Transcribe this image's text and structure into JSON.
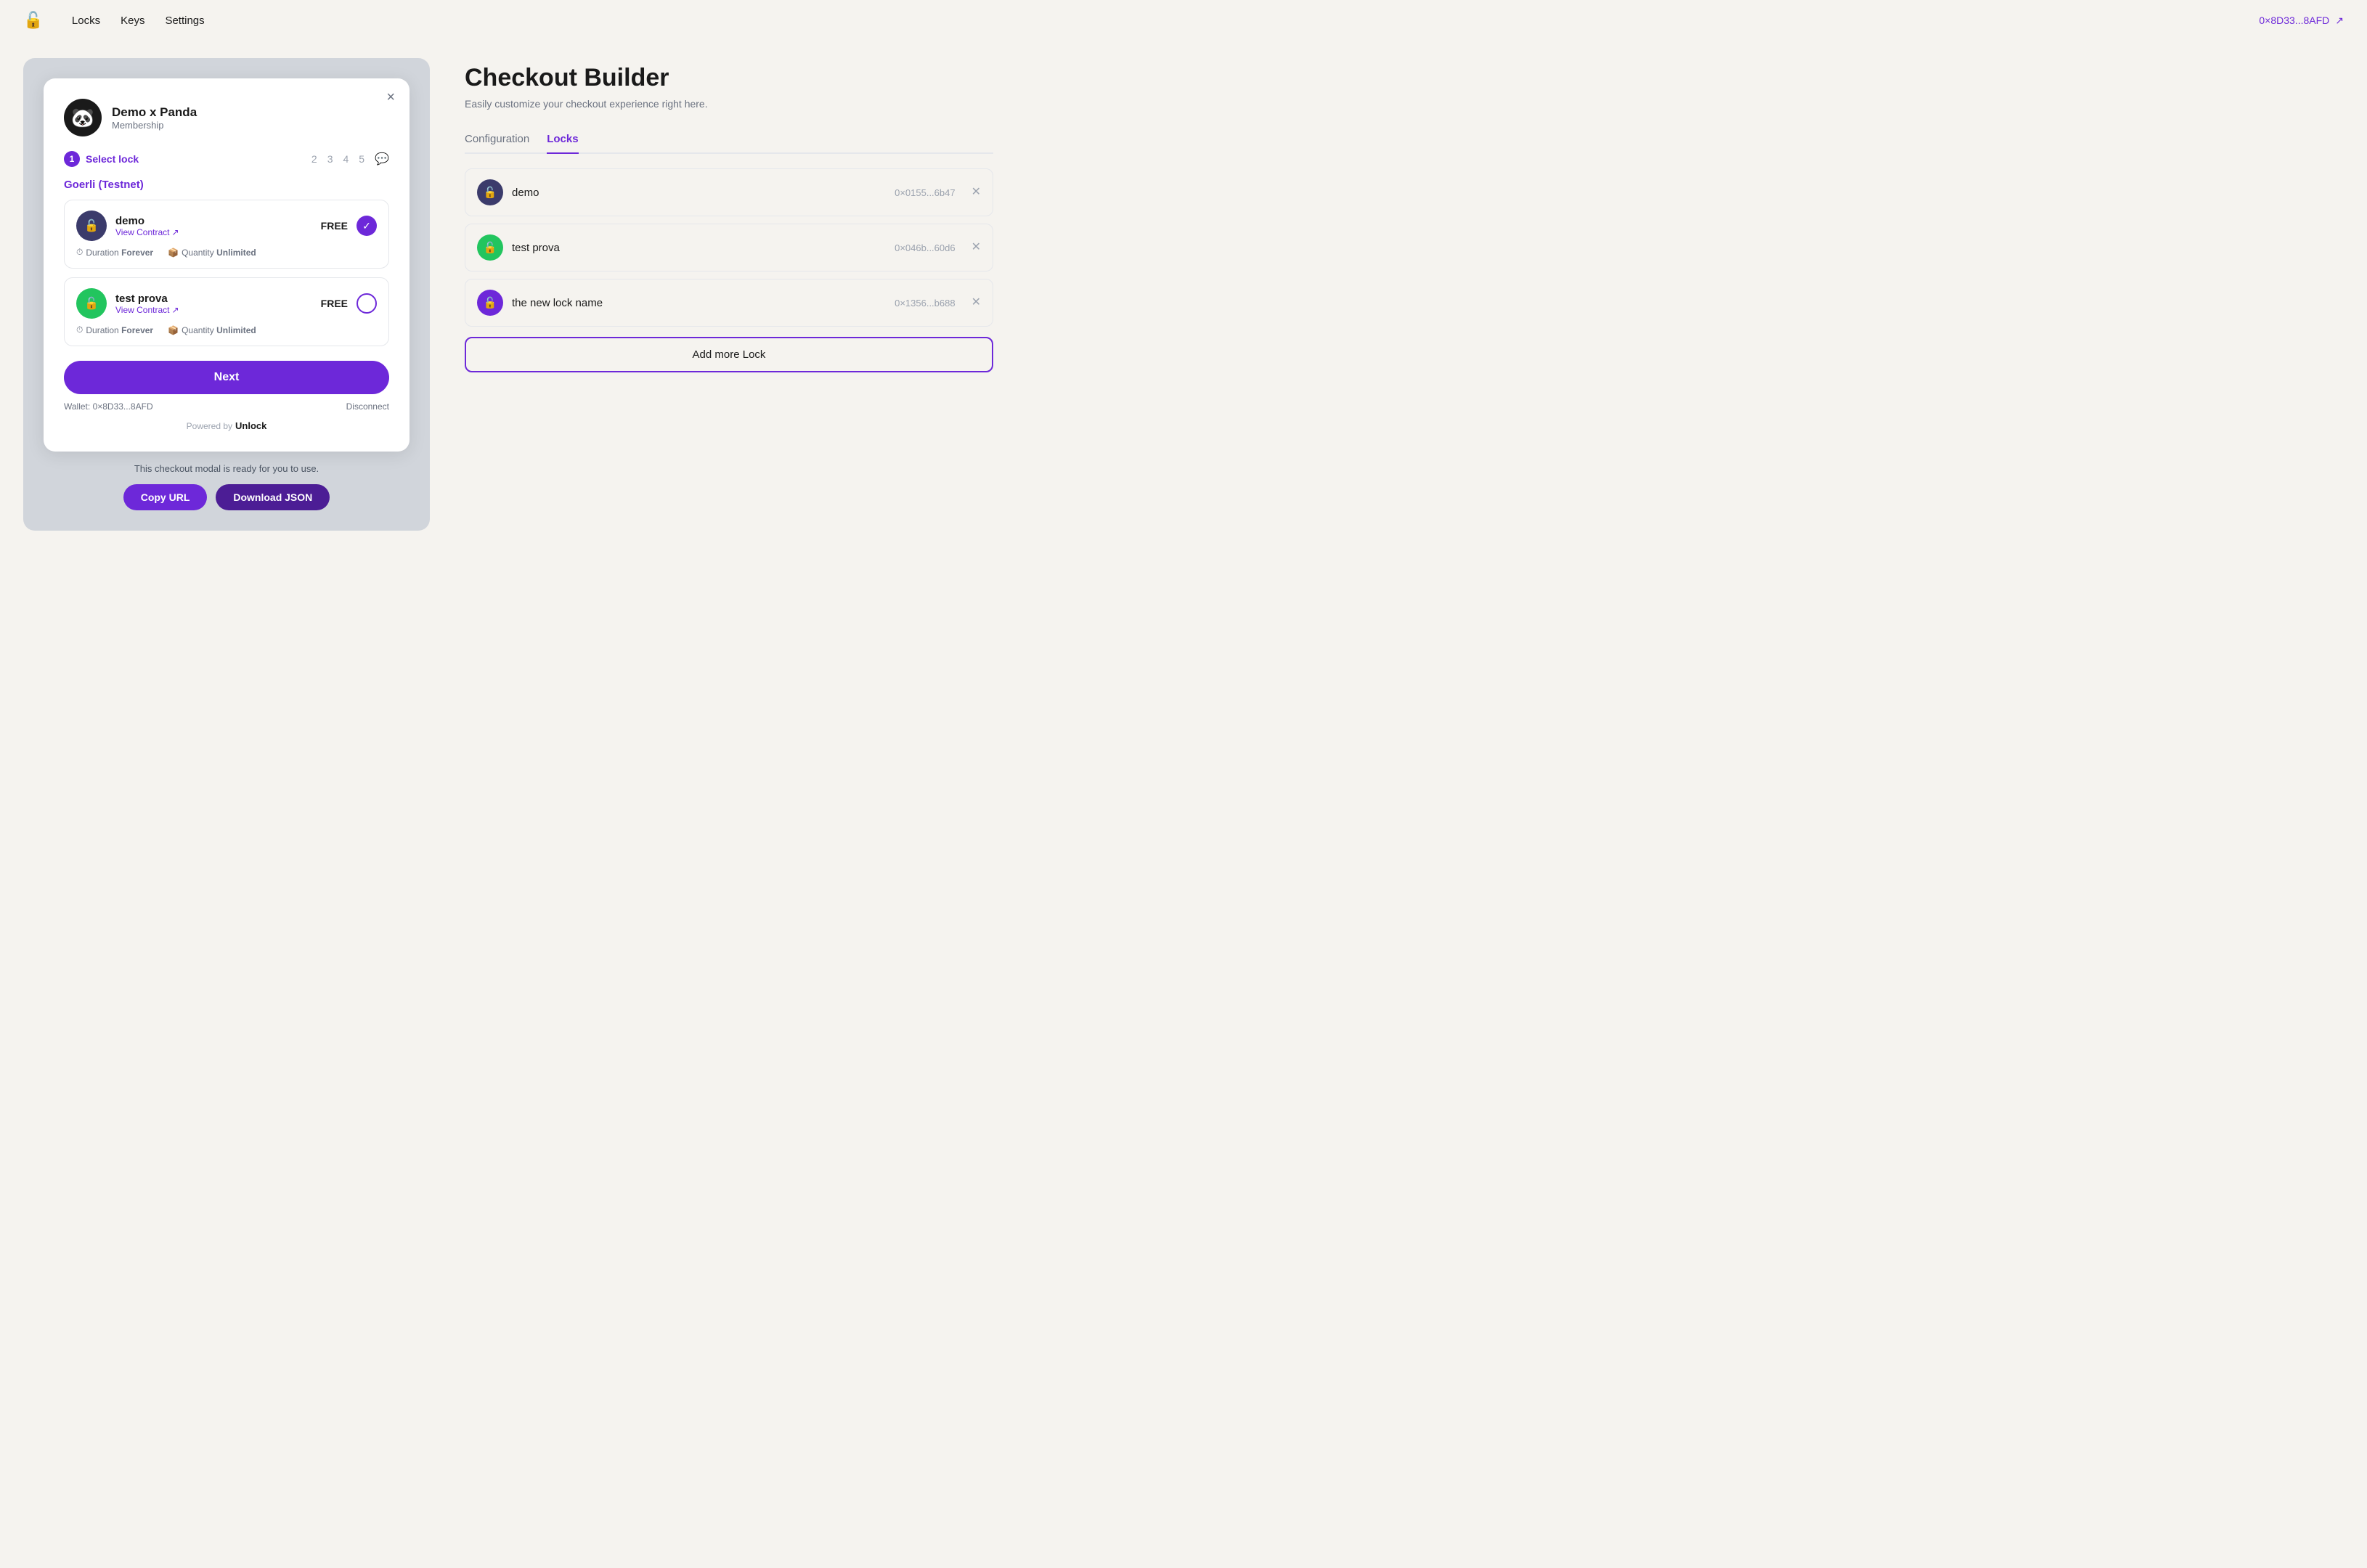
{
  "brand": {
    "name": "Unlock",
    "icon": "🔓"
  },
  "nav": {
    "links": [
      "Locks",
      "Keys",
      "Settings"
    ],
    "wallet": "0×8D33...8AFD"
  },
  "modal": {
    "close_label": "×",
    "panda_emoji": "🐼",
    "title": "Demo x Panda",
    "subtitle": "Membership",
    "step": {
      "number": "1",
      "label": "Select lock",
      "other_steps": [
        "2",
        "3",
        "4",
        "5"
      ],
      "chat_icon": "💬"
    },
    "network": "Goerli (Testnet)",
    "locks": [
      {
        "id": "demo",
        "name": "demo",
        "avatar_bg": "#3b3b6b",
        "avatar_symbol": "🔓",
        "contract_label": "View Contract",
        "price": "FREE",
        "duration": "Forever",
        "quantity": "Unlimited",
        "checked": true
      },
      {
        "id": "test-prova",
        "name": "test prova",
        "avatar_bg": "#22c55e",
        "avatar_symbol": "🔓",
        "contract_label": "View Contract",
        "price": "FREE",
        "duration": "Forever",
        "quantity": "Unlimited",
        "checked": false
      }
    ],
    "next_button": "Next",
    "wallet_label": "Wallet: 0×8D33...8AFD",
    "disconnect_label": "Disconnect",
    "powered_by": "Powered by",
    "powered_brand": "Unlock"
  },
  "checkout_ready_text": "This checkout modal is ready for you to use.",
  "copy_url_label": "Copy URL",
  "download_json_label": "Download JSON",
  "right": {
    "title": "Checkout Builder",
    "subtitle": "Easily customize your checkout experience right here.",
    "tabs": [
      {
        "id": "configuration",
        "label": "Configuration",
        "active": false
      },
      {
        "id": "locks",
        "label": "Locks",
        "active": true
      }
    ],
    "locks": [
      {
        "name": "demo",
        "address": "0×0155...6b47",
        "avatar_bg": "#3b3b6b",
        "avatar_symbol": "🔓"
      },
      {
        "name": "test prova",
        "address": "0×046b...60d6",
        "avatar_bg": "#22c55e",
        "avatar_symbol": "🔓"
      },
      {
        "name": "the new lock name",
        "address": "0×1356...b688",
        "avatar_bg": "#6d28d9",
        "avatar_symbol": "🔓"
      }
    ],
    "add_more_label": "Add more Lock"
  }
}
